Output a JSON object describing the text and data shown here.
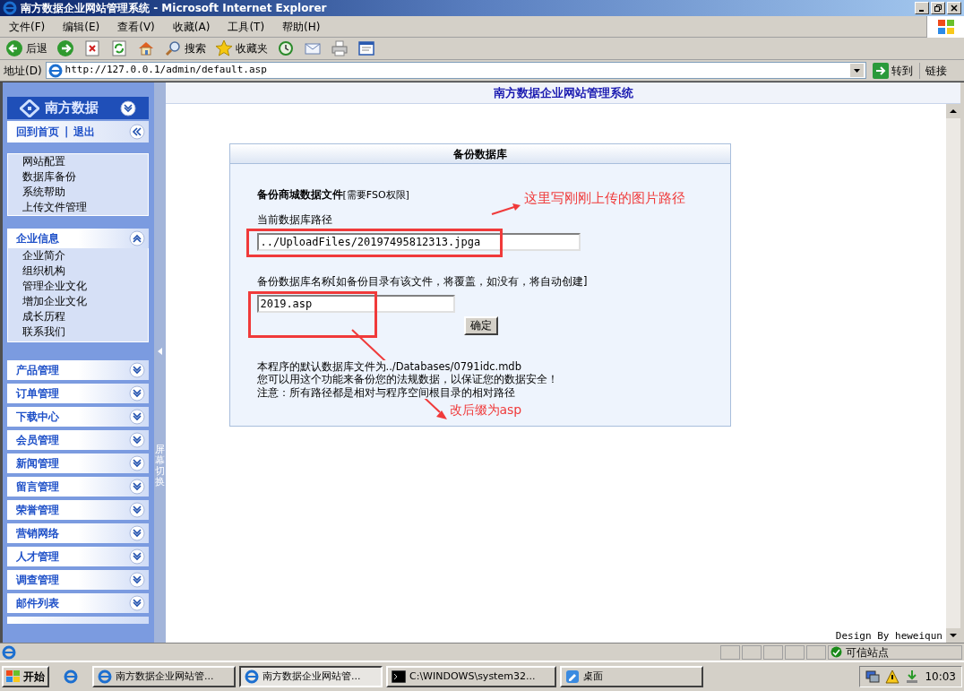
{
  "window": {
    "title": "南方数据企业网站管理系统 - Microsoft Internet Explorer"
  },
  "menu": [
    {
      "label": "文件(F)"
    },
    {
      "label": "编辑(E)"
    },
    {
      "label": "查看(V)"
    },
    {
      "label": "收藏(A)"
    },
    {
      "label": "工具(T)"
    },
    {
      "label": "帮助(H)"
    }
  ],
  "toolbar": [
    {
      "kind": "back",
      "label": "后退"
    },
    {
      "kind": "forward"
    },
    {
      "kind": "stop"
    },
    {
      "kind": "refresh"
    },
    {
      "kind": "home"
    },
    {
      "kind": "search",
      "label": "搜索"
    },
    {
      "kind": "favorites",
      "label": "收藏夹"
    },
    {
      "kind": "history"
    },
    {
      "kind": "mail"
    },
    {
      "kind": "print"
    },
    {
      "kind": "edit"
    }
  ],
  "address": {
    "label": "地址(D)",
    "value": "http://127.0.0.1/admin/default.asp",
    "go": "转到",
    "links": "链接"
  },
  "sidebar": {
    "logo": "南方数据",
    "top_links": [
      "回到首页",
      "退出"
    ],
    "top_links_separator": "|",
    "system_items": [
      "网站配置",
      "数据库备份",
      "系统帮助",
      "上传文件管理"
    ],
    "sections": [
      {
        "title": "企业信息",
        "expanded": true,
        "items": [
          "企业简介",
          "组织机构",
          "管理企业文化",
          "增加企业文化",
          "成长历程",
          "联系我们"
        ]
      },
      {
        "title": "产品管理",
        "expanded": false
      },
      {
        "title": "订单管理",
        "expanded": false
      },
      {
        "title": "下载中心",
        "expanded": false
      },
      {
        "title": "会员管理",
        "expanded": false
      },
      {
        "title": "新闻管理",
        "expanded": false
      },
      {
        "title": "留言管理",
        "expanded": false
      },
      {
        "title": "荣誉管理",
        "expanded": false
      },
      {
        "title": "营销网络",
        "expanded": false
      },
      {
        "title": "人才管理",
        "expanded": false
      },
      {
        "title": "调查管理",
        "expanded": false
      },
      {
        "title": "邮件列表",
        "expanded": false
      }
    ],
    "toggle_label": "屏幕切换"
  },
  "page_header": "南方数据企业网站管理系统",
  "panel": {
    "title": "备份数据库",
    "heading": "备份商城数据文件",
    "heading_note": "[需要FSO权限]",
    "fields": [
      {
        "label": "当前数据库路径",
        "value": "../UploadFiles/20197495812313.jpga"
      },
      {
        "label": "备份数据库名称[如备份目录有该文件，将覆盖，如没有，将自动创建]",
        "value": "2019.asp"
      }
    ],
    "submit": "确定",
    "notes": [
      "本程序的默认数据库文件为../Databases/0791idc.mdb",
      "您可以用这个功能来备份您的法规数据，以保证您的数据安全！",
      "注意：所有路径都是相对与程序空间根目录的相对路径"
    ]
  },
  "annotations": [
    {
      "text": "这里写刚刚上传的图片路径"
    },
    {
      "text": "改后缀为asp"
    }
  ],
  "footer": "Design By heweiqun",
  "status_bar": {
    "zone": "可信站点"
  },
  "taskbar": {
    "start": "开始",
    "tasks": [
      {
        "kind": "ie",
        "label": "南方数据企业网站管...",
        "selected": false
      },
      {
        "kind": "ie",
        "label": "南方数据企业网站管...",
        "selected": true
      },
      {
        "kind": "console",
        "label": "C:\\WINDOWS\\system32...",
        "selected": false
      },
      {
        "kind": "desktop",
        "label": "桌面",
        "selected": false
      }
    ],
    "clock": "10:03"
  }
}
